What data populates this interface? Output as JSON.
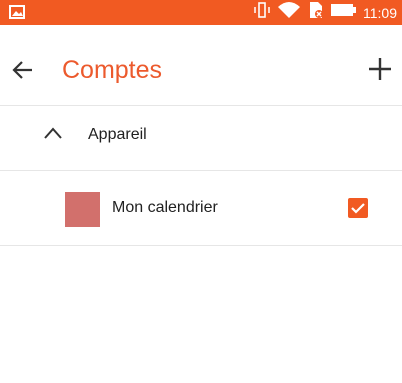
{
  "status_bar": {
    "time": "11:09",
    "icons": [
      "image-icon",
      "vibrate-icon",
      "wifi-icon",
      "sim-icon",
      "battery-icon"
    ],
    "color": "#f15a22"
  },
  "toolbar": {
    "title": "Comptes",
    "back_icon": "arrow-left-icon",
    "add_icon": "plus-icon",
    "accent": "#ec5a2d"
  },
  "section": {
    "label": "Appareil",
    "icon": "chevron-up-icon"
  },
  "accounts": [
    {
      "label": "Mon calendrier",
      "color": "#d2706c",
      "checked": true
    }
  ]
}
